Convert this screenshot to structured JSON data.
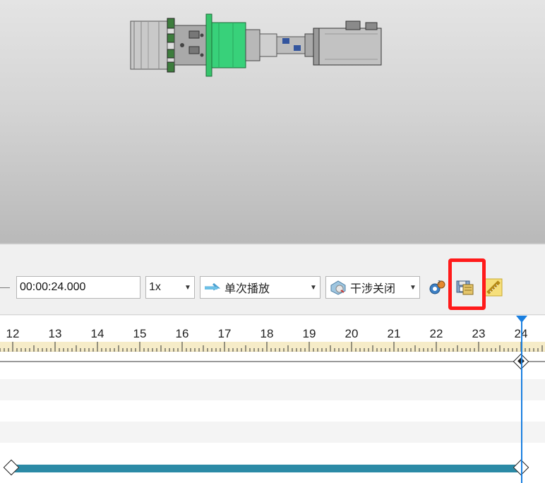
{
  "toolbar": {
    "time_value": "00:00:24.000",
    "speed": {
      "selected": "1x"
    },
    "playback_mode": {
      "selected": "单次播放",
      "icon": "arrow-right-icon"
    },
    "interference": {
      "selected": "干涉关闭",
      "icon": "interference-icon"
    },
    "buttons": [
      {
        "name": "collision-settings-icon"
      },
      {
        "name": "save-animation-icon"
      },
      {
        "name": "measure-icon"
      }
    ]
  },
  "timeline": {
    "ticks": [
      "12",
      "13",
      "14",
      "15",
      "16",
      "17",
      "18",
      "19",
      "20",
      "21",
      "22",
      "23",
      "24"
    ],
    "current_time": "24"
  },
  "colors": {
    "accent_bar": "#2b8aa6",
    "cursor": "#1a7fe0",
    "highlight": "#ff1a1a",
    "ruler_band": "#f6ecc8"
  }
}
